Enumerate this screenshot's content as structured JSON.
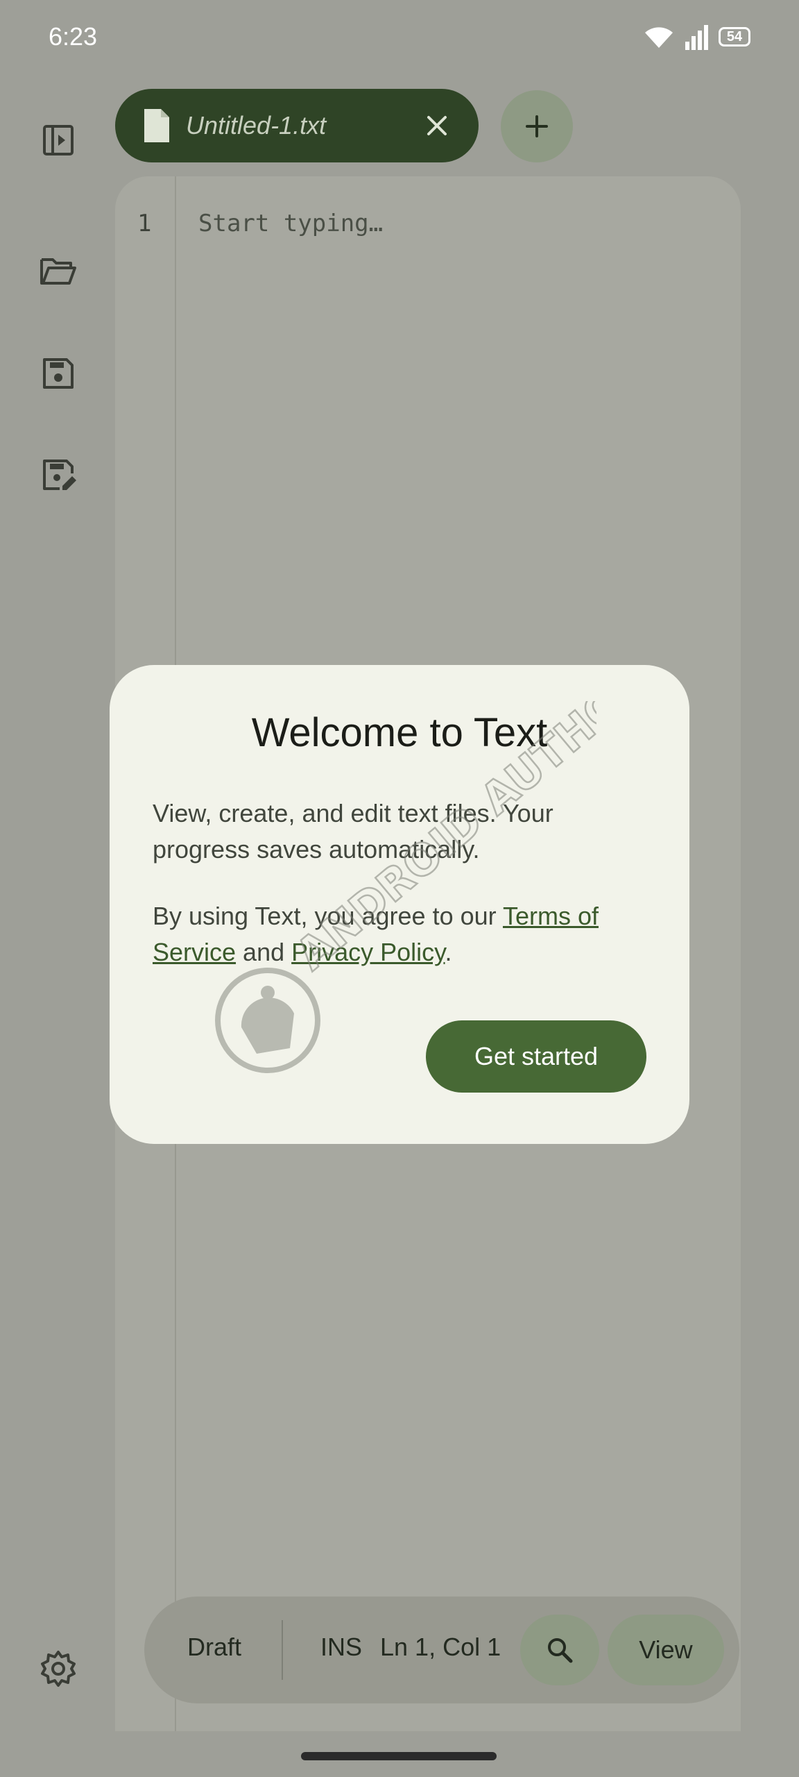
{
  "status_bar": {
    "time": "6:23",
    "battery": "54"
  },
  "rail": {
    "items": [
      {
        "name": "sidebar-toggle-icon"
      },
      {
        "name": "open-folder-icon"
      },
      {
        "name": "save-icon"
      },
      {
        "name": "save-as-icon"
      }
    ]
  },
  "tab": {
    "label": "Untitled-1.txt"
  },
  "editor": {
    "line_number": "1",
    "placeholder": "Start typing…"
  },
  "bottom_bar": {
    "mode": "Draft",
    "insert": "INS",
    "position": "Ln 1, Col 1",
    "view_label": "View"
  },
  "dialog": {
    "title": "Welcome to Text",
    "body1": "View, create, and edit text files. Your progress saves automatically.",
    "body2_prefix": "By using Text, you agree to our ",
    "terms_link": "Terms of Service",
    "body2_middle": " and ",
    "privacy_link": "Privacy Policy",
    "body2_suffix": ".",
    "button": "Get started"
  },
  "watermark": {
    "text": "ANDROID AUTHORITY"
  },
  "colors": {
    "background": "#9e9f98",
    "tab_active": "#2f4426",
    "primary_button": "#476935",
    "dialog_surface": "#f2f3ea"
  }
}
